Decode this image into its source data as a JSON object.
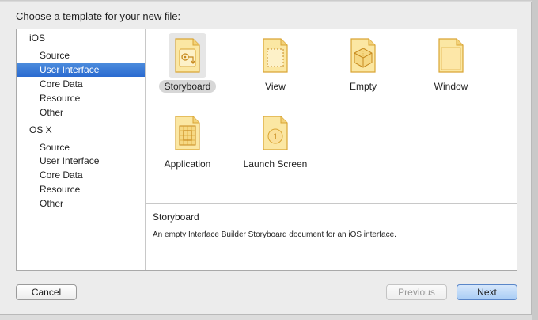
{
  "dialog": {
    "title": "Choose a template for your new file:"
  },
  "sidebar": {
    "groups": [
      {
        "label": "iOS",
        "items": [
          "Source",
          "User Interface",
          "Core Data",
          "Resource",
          "Other"
        ]
      },
      {
        "label": "OS X",
        "items": [
          "Source",
          "User Interface",
          "Core Data",
          "Resource",
          "Other"
        ]
      }
    ],
    "selected": "iOS / User Interface"
  },
  "templates": [
    {
      "label": "Storyboard",
      "icon": "storyboard-icon",
      "selected": true
    },
    {
      "label": "View",
      "icon": "view-icon",
      "selected": false
    },
    {
      "label": "Empty",
      "icon": "empty-cube-icon",
      "selected": false
    },
    {
      "label": "Window",
      "icon": "window-icon",
      "selected": false
    },
    {
      "label": "Application",
      "icon": "application-icon",
      "selected": false
    },
    {
      "label": "Launch Screen",
      "icon": "launch-screen-icon",
      "selected": false
    }
  ],
  "description": {
    "title": "Storyboard",
    "body": "An empty Interface Builder Storyboard document for an iOS interface."
  },
  "buttons": {
    "cancel": "Cancel",
    "previous": "Previous",
    "next": "Next"
  },
  "colors": {
    "selection": "#2f6fd2",
    "icon_fill": "#fbe7a3",
    "icon_stroke": "#d9a534"
  }
}
